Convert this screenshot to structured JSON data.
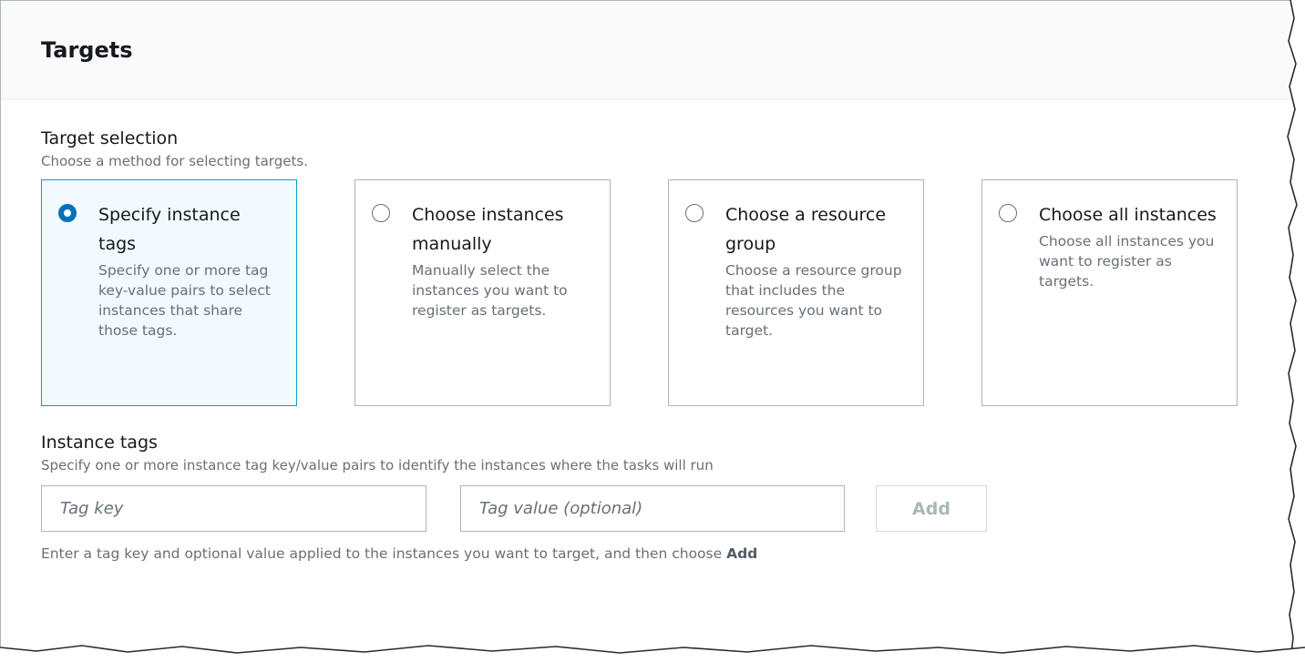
{
  "panel": {
    "title": "Targets"
  },
  "target_selection": {
    "label": "Target selection",
    "description": "Choose a method for selecting targets.",
    "options": [
      {
        "title": "Specify instance tags",
        "description": "Specify one or more tag key-value pairs to select instances that share those tags.",
        "selected": true
      },
      {
        "title": "Choose instances manually",
        "description": "Manually select the instances you want to register as targets.",
        "selected": false
      },
      {
        "title": "Choose a resource group",
        "description": "Choose a resource group that includes the resources you want to target.",
        "selected": false
      },
      {
        "title": "Choose all instances",
        "description": "Choose all instances you want to register as targets.",
        "selected": false
      }
    ]
  },
  "instance_tags": {
    "label": "Instance tags",
    "description": "Specify one or more instance tag key/value pairs to identify the instances where the tasks will run",
    "tag_key_placeholder": "Tag key",
    "tag_value_placeholder": "Tag value (optional)",
    "add_label": "Add",
    "hint_prefix": "Enter a tag key and optional value applied to the instances you want to target, and then choose ",
    "hint_bold": "Add"
  },
  "colors": {
    "selected_border": "#00a1c9",
    "selected_bg": "#f1faff",
    "radio_selected": "#0073bb"
  }
}
